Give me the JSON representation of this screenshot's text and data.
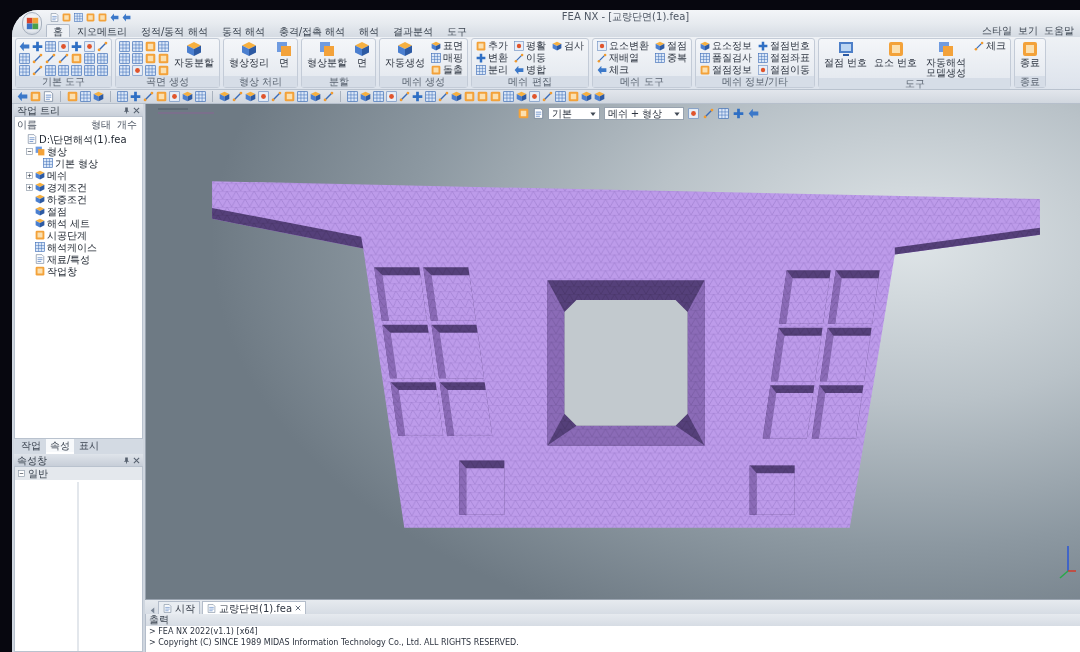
{
  "window": {
    "title": "FEA NX - [교량단면(1).fea]"
  },
  "ribbon": {
    "tabs": [
      {
        "label": "홈",
        "selected": true
      },
      {
        "label": "지오메트리",
        "selected": false
      },
      {
        "label": "정적/동적 해석",
        "selected": false
      },
      {
        "label": "동적 해석",
        "selected": false
      },
      {
        "label": "충격/접촉 해석",
        "selected": false
      },
      {
        "label": "해석",
        "selected": false
      },
      {
        "label": "결과분석",
        "selected": false
      },
      {
        "label": "도구",
        "selected": false
      }
    ],
    "menu": [
      "스타일",
      "보기",
      "도움말"
    ],
    "groups": [
      {
        "label": "기본 도구",
        "buttons": [
          {
            "kind": "tool_grid"
          }
        ]
      },
      {
        "label": "곡면 생성",
        "buttons": [
          {
            "kind": "tool_grid"
          },
          {
            "kind": "large",
            "label": "자동분할"
          }
        ]
      },
      {
        "label": "형상 처리",
        "buttons": [
          {
            "kind": "large",
            "label": "형상정리"
          },
          {
            "kind": "large",
            "label": "면"
          }
        ]
      },
      {
        "label": "분할",
        "buttons": [
          {
            "kind": "large",
            "label": "형상분할"
          },
          {
            "kind": "large",
            "label": "면"
          }
        ]
      },
      {
        "label": "메쉬 생성",
        "buttons": [
          {
            "kind": "large",
            "label": "자동생성"
          },
          {
            "kind": "small",
            "label": "표면"
          },
          {
            "kind": "small",
            "label": "매핑"
          },
          {
            "kind": "small",
            "label": "돌출"
          }
        ]
      },
      {
        "label": "메쉬 편집",
        "buttons": [
          {
            "kind": "small",
            "label": "추가"
          },
          {
            "kind": "small",
            "label": "변환"
          },
          {
            "kind": "small",
            "label": "분리"
          },
          {
            "kind": "small",
            "label": "평활"
          },
          {
            "kind": "small",
            "label": "이동"
          },
          {
            "kind": "small",
            "label": "병합"
          },
          {
            "kind": "small",
            "label": "검사"
          }
        ]
      },
      {
        "label": "메쉬 도구",
        "buttons": [
          {
            "kind": "small",
            "label": "요소변환"
          },
          {
            "kind": "small",
            "label": "재배열"
          },
          {
            "kind": "small",
            "label": "체크"
          },
          {
            "kind": "small",
            "label": "절점"
          },
          {
            "kind": "small",
            "label": "중복"
          }
        ]
      },
      {
        "label": "메쉬 정보/기타",
        "buttons": [
          {
            "kind": "small",
            "label": "요소정보"
          },
          {
            "kind": "small",
            "label": "품질검사"
          },
          {
            "kind": "small",
            "label": "절점정보"
          },
          {
            "kind": "small",
            "label": "절점번호"
          },
          {
            "kind": "small",
            "label": "절점좌표"
          },
          {
            "kind": "small",
            "label": "절점이동"
          }
        ]
      },
      {
        "label": "도구",
        "buttons": [
          {
            "kind": "large",
            "label": "절점 번호"
          },
          {
            "kind": "large",
            "label": "요소 번호"
          },
          {
            "kind": "large",
            "label": "자동해석 모델생성"
          },
          {
            "kind": "small",
            "label": "체크"
          }
        ]
      },
      {
        "label": "종료",
        "buttons": [
          {
            "kind": "large",
            "label": "종료"
          }
        ]
      }
    ]
  },
  "tree_panel": {
    "title": "작업 트리",
    "columns": [
      "이름",
      "형태",
      "개수"
    ],
    "root": {
      "label": "D:\\단면해석(1).fea",
      "children": [
        {
          "label": "형상",
          "expanded": true,
          "children": [
            {
              "label": "기본 형상"
            }
          ]
        },
        {
          "label": "메쉬",
          "expanded": false
        },
        {
          "label": "경계조건",
          "expanded": false
        },
        {
          "label": "하중조건"
        },
        {
          "label": "절점"
        },
        {
          "label": "해석 세트"
        },
        {
          "label": "시공단계"
        },
        {
          "label": "해석케이스"
        },
        {
          "label": "재료/특성"
        },
        {
          "label": "작업창"
        }
      ]
    },
    "tabs": [
      {
        "label": "작업",
        "selected": false
      },
      {
        "label": "속성",
        "selected": true
      },
      {
        "label": "표시",
        "selected": false
      }
    ]
  },
  "property_panel": {
    "title": "속성창",
    "category": {
      "label": "일반",
      "expanded": true
    }
  },
  "viewport": {
    "dropdowns": [
      "기본",
      "메쉬 + 형상"
    ]
  },
  "document_tabs": [
    {
      "label": "시작",
      "selected": false
    },
    {
      "label": "교량단면(1).fea",
      "selected": true
    }
  ],
  "output_panel": {
    "title": "출력",
    "lines": [
      "> FEA NX 2022(v1.1) [x64]",
      "> Copyright (C) SINCE 1989 MIDAS Information Technology Co., Ltd. ALL RIGHTS RESERVED."
    ]
  }
}
